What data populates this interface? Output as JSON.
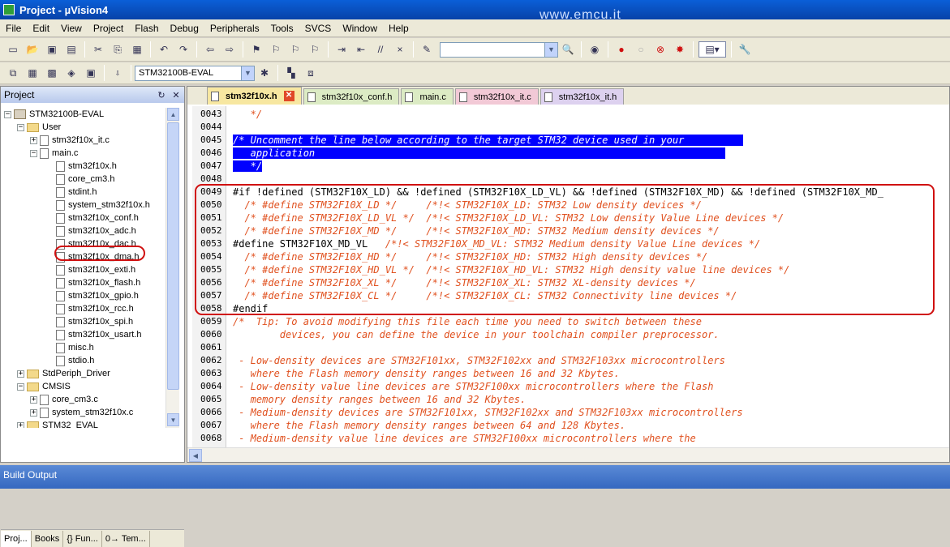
{
  "window": {
    "title": "Project  -  µVision4",
    "watermark": "www.emcu.it"
  },
  "menu": [
    "File",
    "Edit",
    "View",
    "Project",
    "Flash",
    "Debug",
    "Peripherals",
    "Tools",
    "SVCS",
    "Window",
    "Help"
  ],
  "toolbar2": {
    "target_select": "STM32100B-EVAL"
  },
  "project_panel": {
    "title": "Project",
    "tree": [
      {
        "label": "STM32100B-EVAL",
        "type": "project",
        "expander": "−"
      },
      {
        "label": "User",
        "type": "folder",
        "expander": "−"
      },
      {
        "label": "stm32f10x_it.c",
        "type": "file",
        "expander": "+"
      },
      {
        "label": "main.c",
        "type": "file",
        "expander": "−"
      },
      {
        "label": "stm32f10x.h",
        "type": "file",
        "expander": ""
      },
      {
        "label": "core_cm3.h",
        "type": "file",
        "expander": ""
      },
      {
        "label": "stdint.h",
        "type": "file",
        "expander": ""
      },
      {
        "label": "system_stm32f10x.h",
        "type": "file",
        "expander": ""
      },
      {
        "label": "stm32f10x_conf.h",
        "type": "file",
        "expander": ""
      },
      {
        "label": "stm32f10x_adc.h",
        "type": "file",
        "expander": ""
      },
      {
        "label": "stm32f10x_dac.h",
        "type": "file",
        "expander": ""
      },
      {
        "label": "stm32f10x_dma.h",
        "type": "file",
        "expander": ""
      },
      {
        "label": "stm32f10x_exti.h",
        "type": "file",
        "expander": ""
      },
      {
        "label": "stm32f10x_flash.h",
        "type": "file",
        "expander": ""
      },
      {
        "label": "stm32f10x_gpio.h",
        "type": "file",
        "expander": ""
      },
      {
        "label": "stm32f10x_rcc.h",
        "type": "file",
        "expander": ""
      },
      {
        "label": "stm32f10x_spi.h",
        "type": "file",
        "expander": ""
      },
      {
        "label": "stm32f10x_usart.h",
        "type": "file",
        "expander": ""
      },
      {
        "label": "misc.h",
        "type": "file",
        "expander": ""
      },
      {
        "label": "stdio.h",
        "type": "file",
        "expander": ""
      },
      {
        "label": "StdPeriph_Driver",
        "type": "folder",
        "expander": "+"
      },
      {
        "label": "CMSIS",
        "type": "folder",
        "expander": "−"
      },
      {
        "label": "core_cm3.c",
        "type": "file",
        "expander": "+"
      },
      {
        "label": "system_stm32f10x.c",
        "type": "file",
        "expander": "+"
      },
      {
        "label": "STM32_EVAL",
        "type": "folder",
        "expander": "+"
      }
    ],
    "bottom_tabs": [
      "Proj...",
      "Books",
      "{} Fun...",
      "0→ Tem..."
    ]
  },
  "editor": {
    "tabs": [
      {
        "label": "stm32f10x.h",
        "active": true,
        "color": "#f7e7a1"
      },
      {
        "label": "stm32f10x_conf.h",
        "active": false,
        "color": "#dcebc4"
      },
      {
        "label": "main.c",
        "active": false,
        "color": "#dcebc4"
      },
      {
        "label": "stm32f10x_it.c",
        "active": false,
        "color": "#f2c9d6"
      },
      {
        "label": "stm32f10x_it.h",
        "active": false,
        "color": "#ddd1ef"
      }
    ],
    "lines": [
      {
        "n": "0043",
        "t": "   */",
        "k": "cm"
      },
      {
        "n": "0044",
        "t": "",
        "k": "pp"
      },
      {
        "n": "0045",
        "t": "/* Uncomment the line below according to the target STM32 device used in your          ",
        "k": "sel"
      },
      {
        "n": "0046",
        "t": "   application                                                                      ",
        "k": "sel"
      },
      {
        "n": "0047",
        "t": "   */",
        "k": "sel"
      },
      {
        "n": "0048",
        "t": "",
        "k": "pp"
      },
      {
        "n": "0049",
        "t": "#if !defined (STM32F10X_LD) && !defined (STM32F10X_LD_VL) && !defined (STM32F10X_MD) && !defined (STM32F10X_MD_",
        "k": "pp"
      },
      {
        "n": "0050",
        "t": "  /* #define STM32F10X_LD */     /*!< STM32F10X_LD: STM32 Low density devices */",
        "k": "cm"
      },
      {
        "n": "0051",
        "t": "  /* #define STM32F10X_LD_VL */  /*!< STM32F10X_LD_VL: STM32 Low density Value Line devices */",
        "k": "cm"
      },
      {
        "n": "0052",
        "t": "  /* #define STM32F10X_MD */     /*!< STM32F10X_MD: STM32 Medium density devices */",
        "k": "cm"
      },
      {
        "n": "0053",
        "t": "#define STM32F10X_MD_VL   ",
        "k": "pp",
        "c": "/*!< STM32F10X_MD_VL: STM32 Medium density Value Line devices */"
      },
      {
        "n": "0054",
        "t": "  /* #define STM32F10X_HD */     /*!< STM32F10X_HD: STM32 High density devices */",
        "k": "cm"
      },
      {
        "n": "0055",
        "t": "  /* #define STM32F10X_HD_VL */  /*!< STM32F10X_HD_VL: STM32 High density value line devices */",
        "k": "cm"
      },
      {
        "n": "0056",
        "t": "  /* #define STM32F10X_XL */     /*!< STM32F10X_XL: STM32 XL-density devices */",
        "k": "cm"
      },
      {
        "n": "0057",
        "t": "  /* #define STM32F10X_CL */     /*!< STM32F10X_CL: STM32 Connectivity line devices */",
        "k": "cm"
      },
      {
        "n": "0058",
        "t": "#endif",
        "k": "pp"
      },
      {
        "n": "0059",
        "t": "/*  Tip: To avoid modifying this file each time you need to switch between these",
        "k": "cm"
      },
      {
        "n": "0060",
        "t": "        devices, you can define the device in your toolchain compiler preprocessor.",
        "k": "cm"
      },
      {
        "n": "0061",
        "t": "",
        "k": "pp"
      },
      {
        "n": "0062",
        "t": " - Low-density devices are STM32F101xx, STM32F102xx and STM32F103xx microcontrollers",
        "k": "cm"
      },
      {
        "n": "0063",
        "t": "   where the Flash memory density ranges between 16 and 32 Kbytes.",
        "k": "cm"
      },
      {
        "n": "0064",
        "t": " - Low-density value line devices are STM32F100xx microcontrollers where the Flash",
        "k": "cm"
      },
      {
        "n": "0065",
        "t": "   memory density ranges between 16 and 32 Kbytes.",
        "k": "cm"
      },
      {
        "n": "0066",
        "t": " - Medium-density devices are STM32F101xx, STM32F102xx and STM32F103xx microcontrollers",
        "k": "cm"
      },
      {
        "n": "0067",
        "t": "   where the Flash memory density ranges between 64 and 128 Kbytes.",
        "k": "cm"
      },
      {
        "n": "0068",
        "t": " - Medium-density value line devices are STM32F100xx microcontrollers where the",
        "k": "cm"
      }
    ]
  },
  "build_output": {
    "title": "Build Output"
  }
}
